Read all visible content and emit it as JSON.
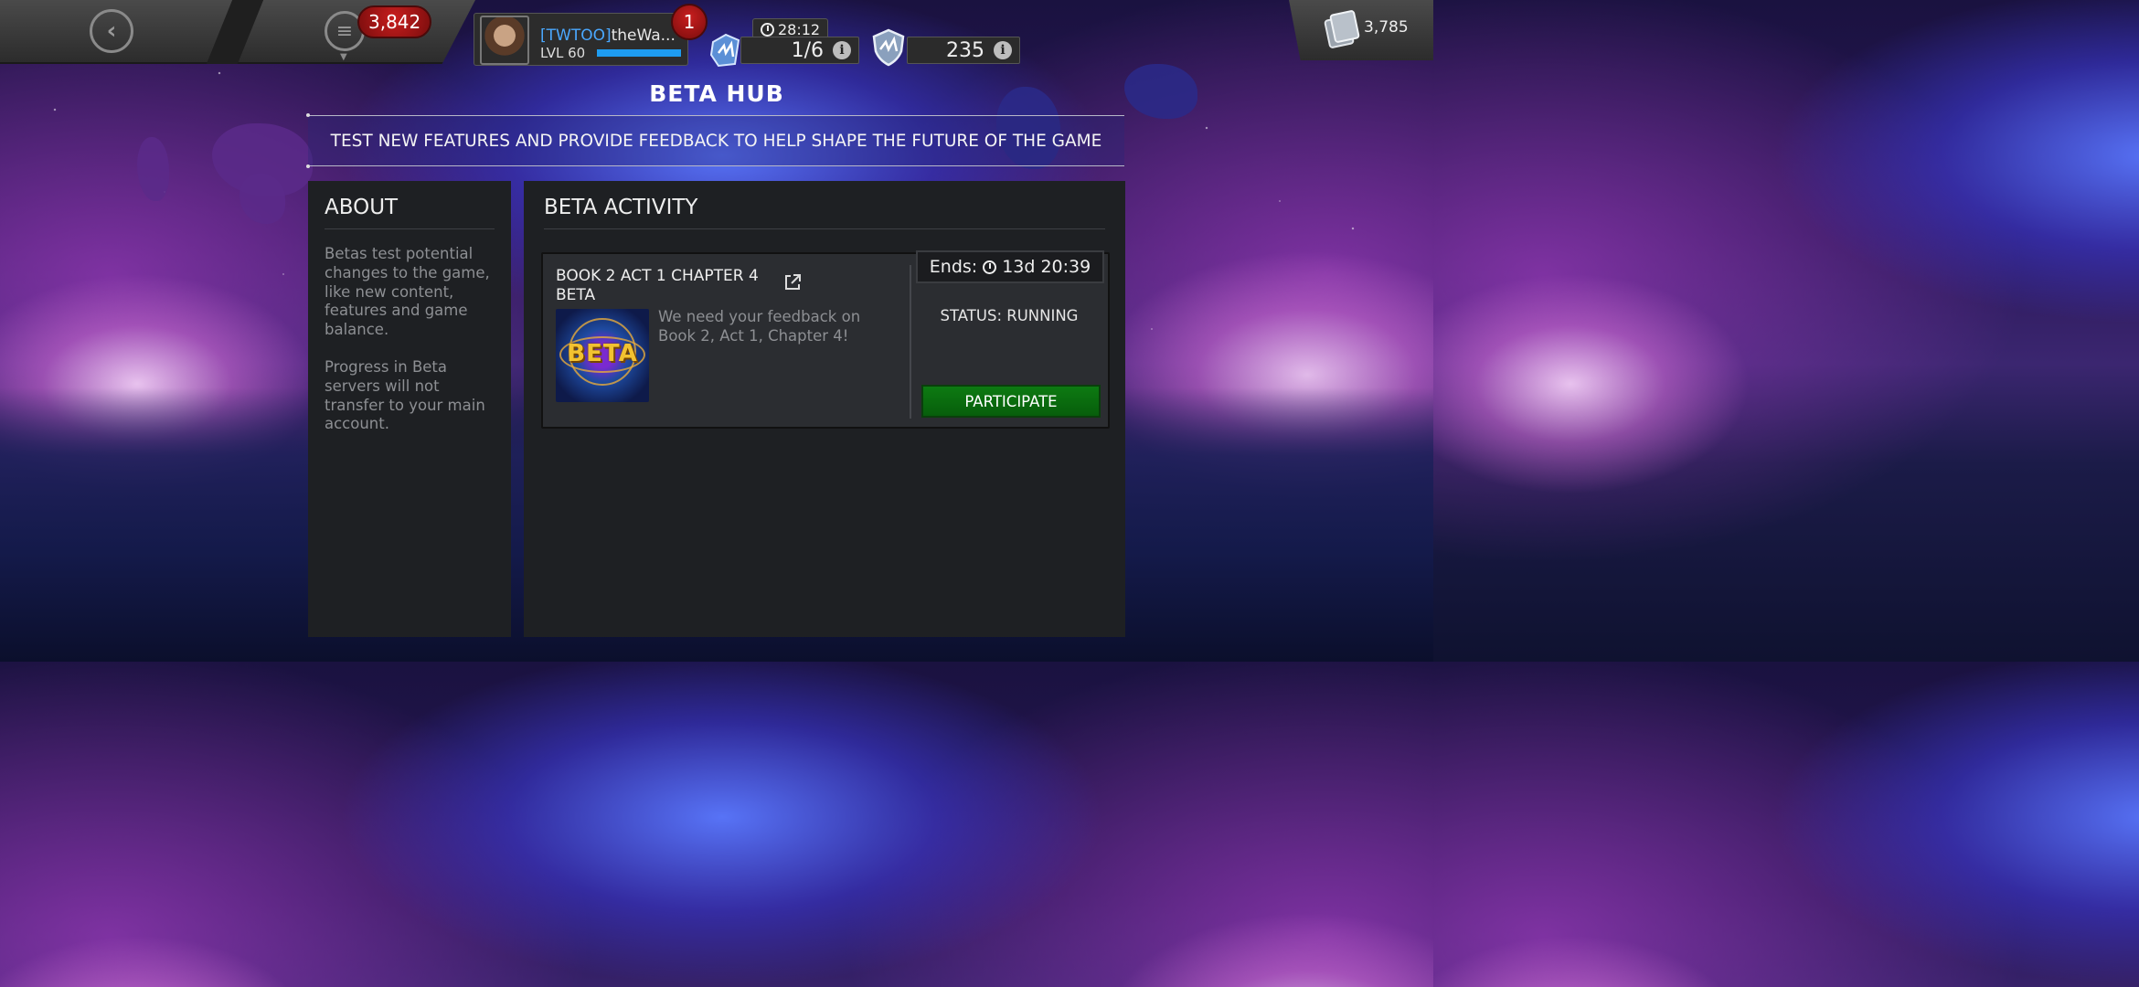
{
  "header": {
    "back_icon": "chevron-left-icon",
    "menu_icon": "menu-icon",
    "notification_count": "3,842",
    "profile": {
      "tag": "[TWTOO]",
      "name": "theWa...",
      "level_label": "LVL 60",
      "level_progress_percent": 100,
      "badge_count": "1"
    },
    "energy": {
      "timer": "28:12",
      "value": "1/6"
    },
    "shield_stat": {
      "value": "235"
    },
    "currency": {
      "value": "3,785"
    }
  },
  "page": {
    "title": "BETA HUB",
    "subtitle": "TEST NEW FEATURES AND PROVIDE FEEDBACK TO HELP SHAPE THE FUTURE OF THE GAME"
  },
  "about": {
    "heading": "ABOUT",
    "paragraphs": [
      "Betas test potential changes to the game, like new content, features and game balance.",
      "Progress in Beta servers will not transfer to your main account."
    ]
  },
  "activity": {
    "heading": "BETA ACTIVITY",
    "card": {
      "title": "BOOK 2 ACT 1 CHAPTER 4 BETA",
      "image_label": "BETA",
      "description": "We need your feedback on Book 2, Act 1, Chapter 4!",
      "ends_label": "Ends:",
      "ends_value": "13d 20:39",
      "status": "STATUS: RUNNING",
      "participate_label": "PARTICIPATE"
    }
  },
  "colors": {
    "accent_green": "#0d7a12",
    "badge_red": "#c81e1e",
    "tag_blue": "#4aa8ff",
    "panel_bg": "#1e2023"
  }
}
